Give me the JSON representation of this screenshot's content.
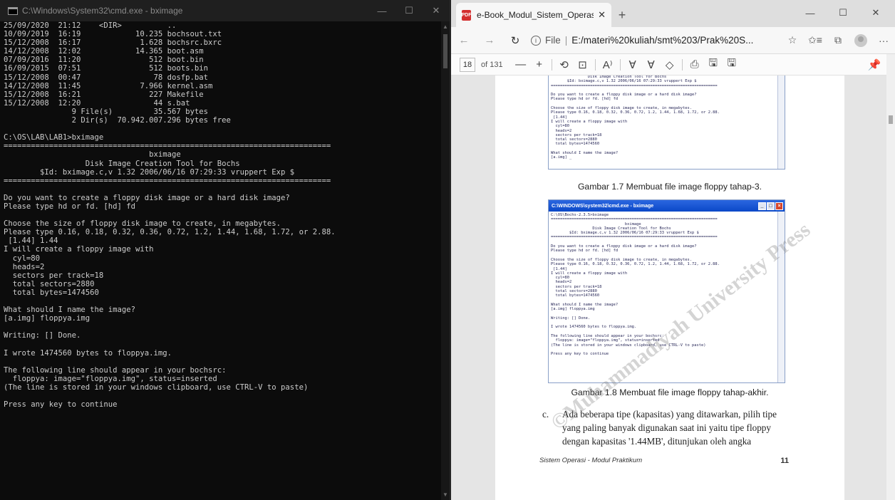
{
  "cmd": {
    "title": "C:\\Windows\\System32\\cmd.exe - bximage",
    "controls": {
      "minimize": "—",
      "maximize": "☐",
      "close": "✕"
    },
    "output": [
      "25/09/2020  21:12    <DIR>          ..",
      "10/09/2019  16:19            10.235 bochsout.txt",
      "15/12/2008  16:17             1.628 bochsrc.bxrc",
      "14/12/2008  12:02            14.365 boot.asm",
      "07/09/2016  11:20               512 boot.bin",
      "16/09/2015  07:51               512 boots.bin",
      "15/12/2008  00:47                78 dosfp.bat",
      "14/12/2008  11:45             7.966 kernel.asm",
      "15/12/2008  16:21               227 Makefile",
      "15/12/2008  12:20                44 s.bat",
      "               9 File(s)         35.567 bytes",
      "               2 Dir(s)  70.942.007.296 bytes free",
      "",
      "C:\\OS\\LAB\\LAB1>bximage",
      "========================================================================",
      "                                bximage",
      "                  Disk Image Creation Tool for Bochs",
      "        $Id: bximage.c,v 1.32 2006/06/16 07:29:33 vruppert Exp $",
      "========================================================================",
      "",
      "Do you want to create a floppy disk image or a hard disk image?",
      "Please type hd or fd. [hd] fd",
      "",
      "Choose the size of floppy disk image to create, in megabytes.",
      "Please type 0.16, 0.18, 0.32, 0.36, 0.72, 1.2, 1.44, 1.68, 1.72, or 2.88.",
      " [1.44] 1.44",
      "I will create a floppy image with",
      "  cyl=80",
      "  heads=2",
      "  sectors per track=18",
      "  total sectors=2880",
      "  total bytes=1474560",
      "",
      "What should I name the image?",
      "[a.img] floppya.img",
      "",
      "Writing: [] Done.",
      "",
      "I wrote 1474560 bytes to floppya.img.",
      "",
      "The following line should appear in your bochsrc:",
      "  floppya: image=\"floppya.img\", status=inserted",
      "(The line is stored in your windows clipboard, use CTRL-V to paste)",
      "",
      "Press any key to continue"
    ]
  },
  "edge": {
    "tab_title": "e-Book_Modul_Sistem_Operasi.p",
    "tab_close": "✕",
    "new_tab": "+",
    "window_controls": {
      "minimize": "—",
      "maximize": "☐",
      "close": "✕"
    },
    "address": {
      "back": "←",
      "forward": "→",
      "refresh": "↻",
      "scheme": "File",
      "url": "E:/materi%20kuliah/smt%203/Prak%20S...",
      "icons": {
        "favorite": "☆",
        "favorites_list": "✩≡",
        "collections": "⧉",
        "more": "···"
      }
    },
    "pdf_toolbar": {
      "page_number": "18",
      "page_of": "of 131",
      "icons": {
        "zoom_out": "—",
        "zoom_in": "+",
        "rotate": "⟲",
        "fit": "⊡",
        "read_aloud": "A⁾",
        "draw": "∀",
        "highlight": "∀",
        "erase": "◇",
        "print": "⎙",
        "save": "🖫",
        "save_as": "🖫",
        "pin": "📌"
      }
    },
    "page": {
      "shot1_lines": [
        "                Disk Image Creation Tool for Bochs",
        "       $Id: bximage.c,v 1.32 2006/06/16 07:29:33 vruppert Exp $",
        "========================================================================",
        "",
        "Do you want to create a floppy disk image or a hard disk image?",
        "Please type hd or fd. [hd] fd",
        "",
        "Choose the size of floppy disk image to create, in megabytes.",
        "Please type 0.16, 0.18, 0.32, 0.36, 0.72, 1.2, 1.44, 1.68, 1.72, or 2.88.",
        " [1.44]",
        "I will create a floppy image with",
        "  cyl=80",
        "  heads=2",
        "  sectors per track=18",
        "  total sectors=2880",
        "  total bytes=1474560",
        "",
        "What should I name the image?",
        "[a.img] _"
      ],
      "caption1": "Gambar 1.7 Membuat file image floppy tahap-3.",
      "shot2_title": "C:\\WINDOWS\\system32\\cmd.exe - bximage",
      "shot2_lines": [
        "C:\\OS\\Bochs-2.3.5>bximage",
        "========================================================================",
        "                                bximage",
        "                  Disk Image Creation Tool for Bochs",
        "        $Id: bximage.c,v 1.32 2006/06/16 07:29:33 vruppert Exp $",
        "========================================================================",
        "",
        "Do you want to create a floppy disk image or a hard disk image?",
        "Please type hd or fd. [hd] fd",
        "",
        "Choose the size of floppy disk image to create, in megabytes.",
        "Please type 0.16, 0.18, 0.32, 0.36, 0.72, 1.2, 1.44, 1.68, 1.72, or 2.88.",
        " [1.44]",
        "I will create a floppy image with",
        "  cyl=80",
        "  heads=2",
        "  sectors per track=18",
        "  total sectors=2880",
        "  total bytes=1474560",
        "",
        "What should I name the image?",
        "[a.img] floppya.img",
        "",
        "Writing: [] Done.",
        "",
        "I wrote 1474560 bytes to floppya.img.",
        "",
        "The following line should appear in your bochsrc:",
        "  floppya: image=\"floppya.img\", status=inserted",
        "(The line is stored in your windows clipboard, use CTRL-V to paste)",
        "",
        "Press any key to continue"
      ],
      "caption2": "Gambar 1.8 Membuat file image floppy tahap-akhir.",
      "list_marker": "c.",
      "list_text": "Ada beberapa tipe (kapasitas) yang ditawarkan, pilih tipe yang paling banyak digunakan saat ini yaitu tipe floppy dengan kapasitas '1.44MB', ditunjukan oleh angka",
      "footer_title": "Sistem Operasi - Modul Praktikum",
      "footer_page": "11",
      "watermark": "©Muhammadiyah University Press"
    }
  }
}
